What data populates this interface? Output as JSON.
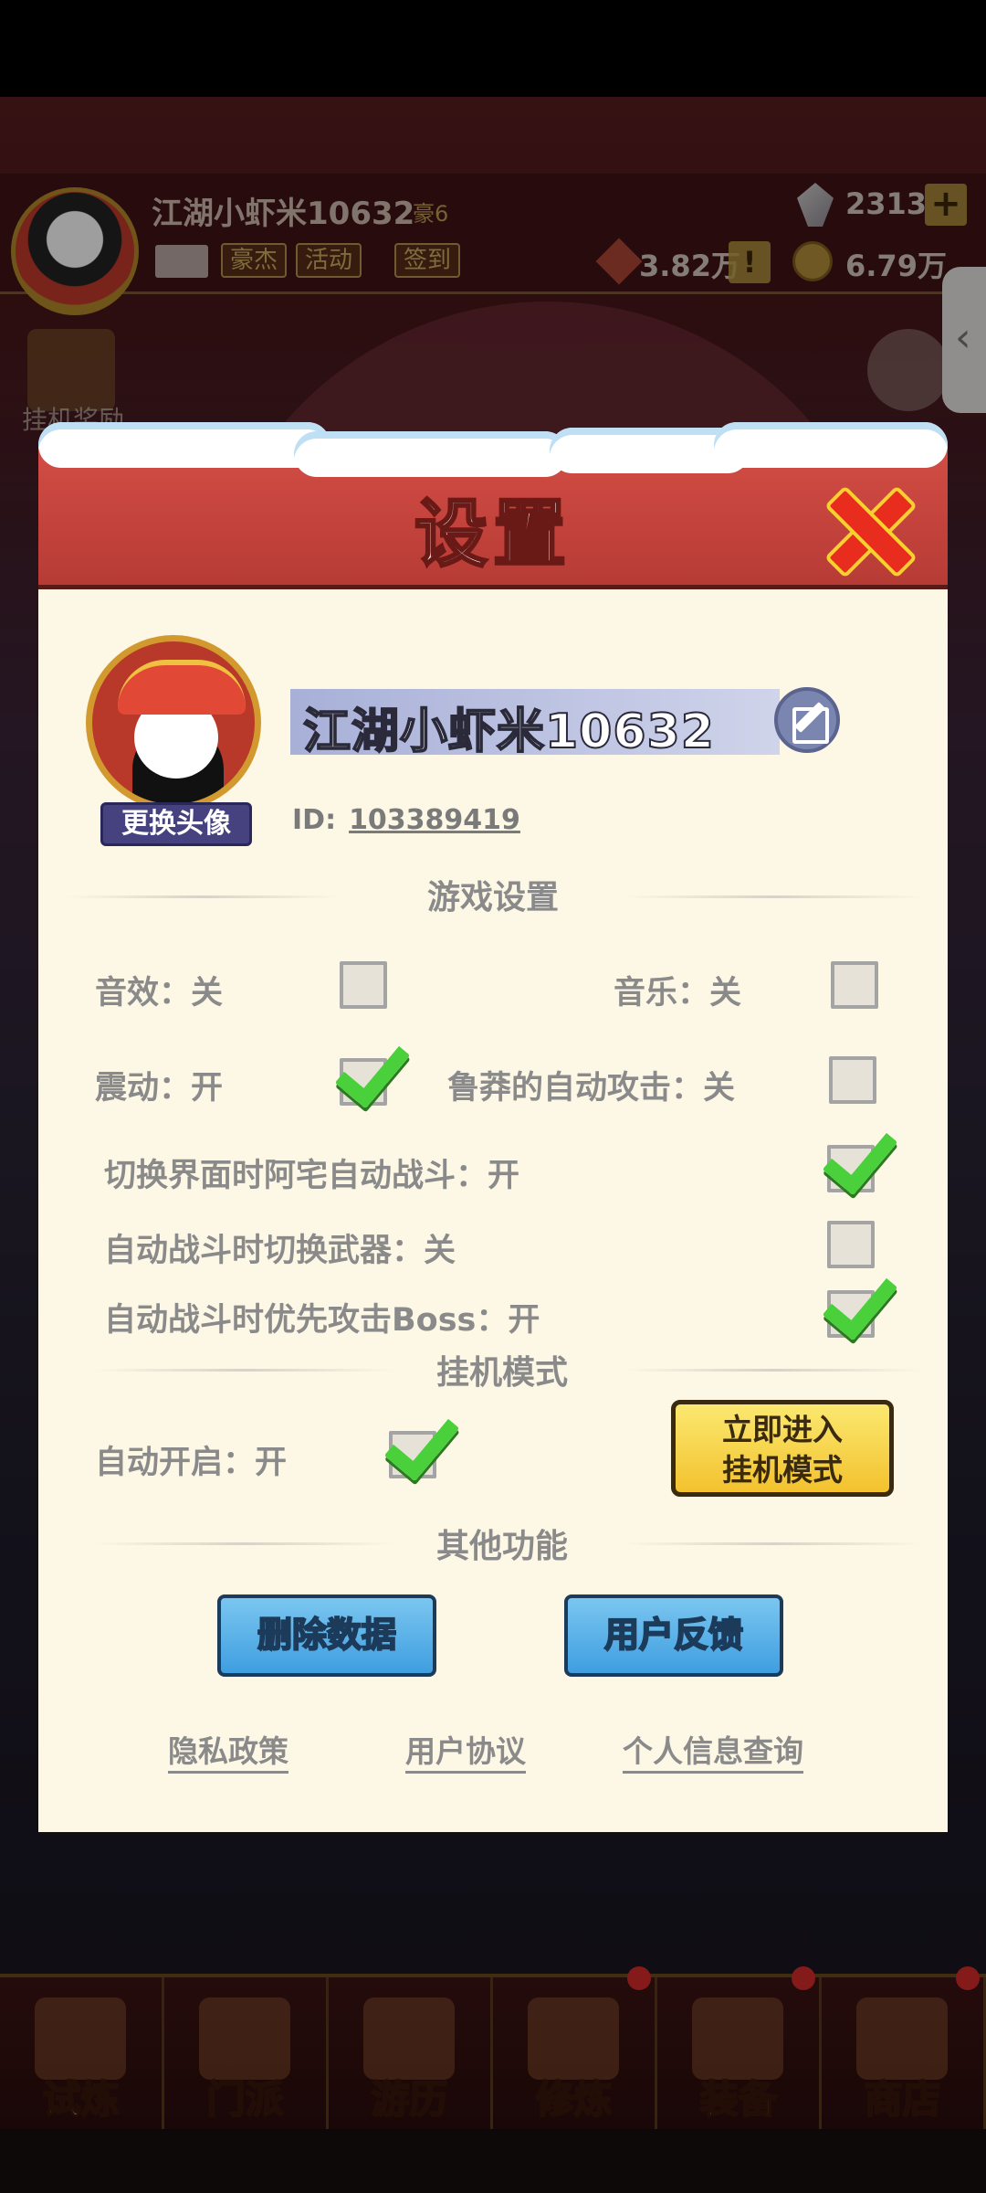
{
  "hud": {
    "player_name": "江湖小虾米10632",
    "rank": "豪6",
    "chips": [
      "豪杰",
      "活动",
      "签到"
    ],
    "gems": "2313",
    "power": "3.82万",
    "coins": "6.79万",
    "side_left_label": "挂机奖励"
  },
  "dialog": {
    "title": "设置",
    "change_avatar": "更换头像",
    "player_name": "江湖小虾米10632",
    "id_label": "ID:",
    "id_value": "103389419"
  },
  "game_settings": {
    "title": "游戏设置",
    "items": [
      {
        "label": "音效：关",
        "checked": false
      },
      {
        "label": "音乐：关",
        "checked": false
      },
      {
        "label": "震动：开",
        "checked": true
      },
      {
        "label": "鲁莽的自动攻击：关",
        "checked": false
      },
      {
        "label": "切换界面时阿宅自动战斗：开",
        "checked": true
      },
      {
        "label": "自动战斗时切换武器：关",
        "checked": false
      },
      {
        "label": "自动战斗时优先攻击Boss：开",
        "checked": true
      }
    ]
  },
  "idle_mode": {
    "title": "挂机模式",
    "auto_label": "自动开启：开",
    "auto_checked": true,
    "enter_line1": "立即进入",
    "enter_line2": "挂机模式"
  },
  "other": {
    "title": "其他功能",
    "delete_data": "删除数据",
    "feedback": "用户反馈",
    "links": [
      "隐私政策",
      "用户协议",
      "个人信息查询"
    ]
  },
  "bottom_nav": [
    "试炼",
    "门派",
    "游历",
    "修炼",
    "装备",
    "商店"
  ],
  "colors": {
    "header_red": "#c2433c",
    "panel_bg": "#fdf7e6",
    "check_green": "#4ad03a",
    "idle_yellow": "#f3c22e",
    "button_blue": "#3f9ee0"
  }
}
